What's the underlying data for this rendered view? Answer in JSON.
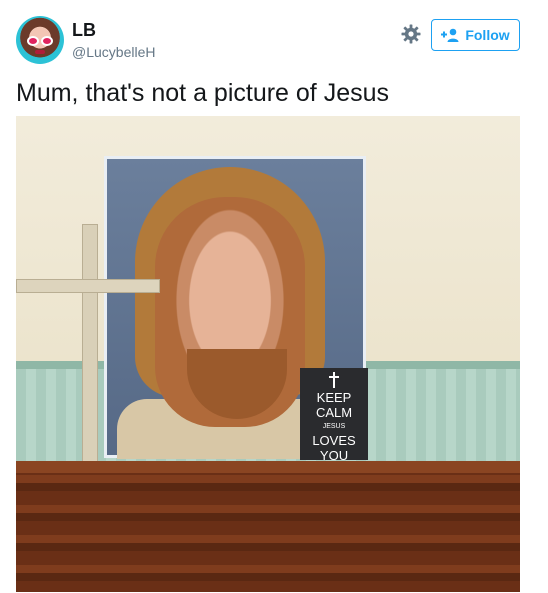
{
  "author": {
    "name": "LB",
    "handle": "@LucybelleH"
  },
  "actions": {
    "follow_label": "Follow",
    "settings_icon": "gear-icon",
    "follow_icon": "add-person-icon"
  },
  "tweet": {
    "text": "Mum, that's not a picture of Jesus"
  },
  "photo": {
    "card_lines": [
      "KEEP",
      "CALM",
      "JESUS",
      "LOVES",
      "YOU"
    ]
  },
  "colors": {
    "accent": "#1da1f2",
    "text": "#14171a",
    "muted": "#657786"
  }
}
